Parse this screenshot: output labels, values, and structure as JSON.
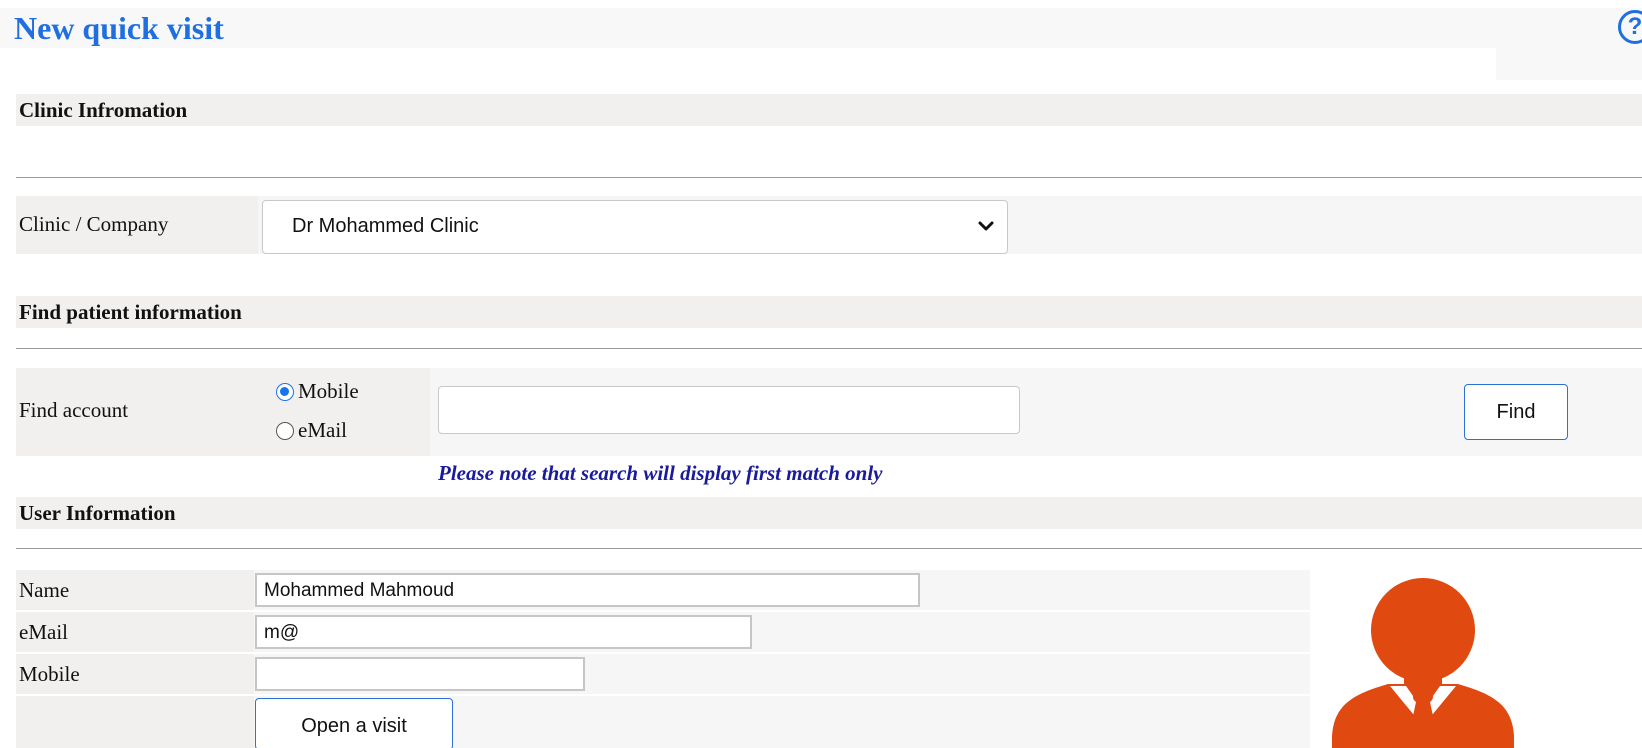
{
  "page": {
    "title": "New quick visit",
    "help_icon": "?",
    "accent_color": "#1f6fe0"
  },
  "sections": {
    "clinic": "Clinic Infromation",
    "find_patient": "Find patient information",
    "user_info": "User Information"
  },
  "clinic": {
    "label": "Clinic / Company",
    "selected": "Dr Mohammed Clinic"
  },
  "find": {
    "label": "Find account",
    "options": [
      "Mobile",
      "eMail"
    ],
    "selected_option": "Mobile",
    "input_value": "",
    "button_label": "Find",
    "note": "Please note that search will display first match only"
  },
  "user": {
    "name_label": "Name",
    "name_value": "Mohammed  Mahmoud",
    "email_label": "eMail",
    "email_value": "m@",
    "mobile_label": "Mobile",
    "mobile_value": "",
    "open_visit_label": "Open a visit",
    "avatar_icon": "user-avatar-icon",
    "avatar_color": "#e04a10"
  }
}
